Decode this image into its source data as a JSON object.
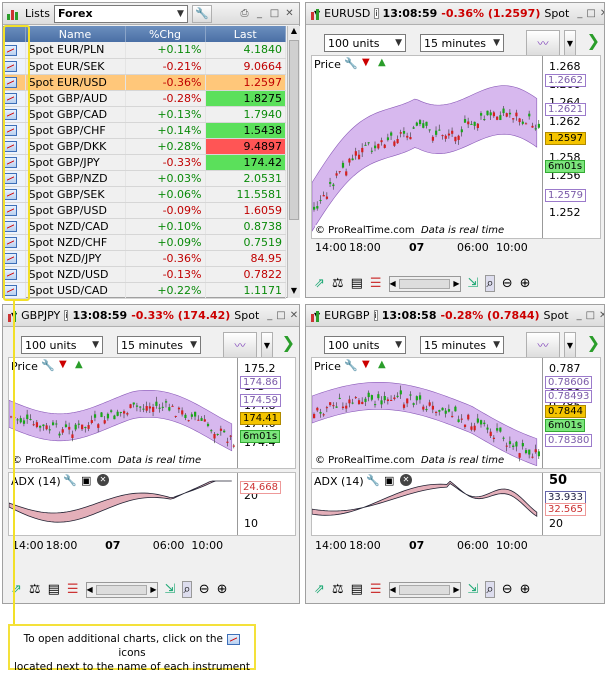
{
  "watchlist": {
    "title": "Lists",
    "list_name": "Forex",
    "columns": [
      "Name",
      "%Chg",
      "Last"
    ],
    "rows": [
      {
        "name": "Spot EUR/PLN",
        "chg": "+0.11%",
        "last": "4.1840",
        "dir": "pos"
      },
      {
        "name": "Spot EUR/SEK",
        "chg": "-0.21%",
        "last": "9.0664",
        "dir": "neg"
      },
      {
        "name": "Spot EUR/USD",
        "chg": "-0.36%",
        "last": "1.2597",
        "dir": "neg",
        "highlight": true
      },
      {
        "name": "Spot GBP/AUD",
        "chg": "-0.28%",
        "last": "1.8275",
        "dir": "neg",
        "flash": "up"
      },
      {
        "name": "Spot GBP/CAD",
        "chg": "+0.13%",
        "last": "1.7940",
        "dir": "pos"
      },
      {
        "name": "Spot GBP/CHF",
        "chg": "+0.14%",
        "last": "1.5438",
        "dir": "pos",
        "flash": "up"
      },
      {
        "name": "Spot GBP/DKK",
        "chg": "+0.28%",
        "last": "9.4897",
        "dir": "pos",
        "flash": "down"
      },
      {
        "name": "Spot GBP/JPY",
        "chg": "-0.33%",
        "last": "174.42",
        "dir": "neg",
        "flash": "up"
      },
      {
        "name": "Spot GBP/NZD",
        "chg": "+0.03%",
        "last": "2.0531",
        "dir": "pos"
      },
      {
        "name": "Spot GBP/SEK",
        "chg": "+0.06%",
        "last": "11.5581",
        "dir": "pos"
      },
      {
        "name": "Spot GBP/USD",
        "chg": "-0.09%",
        "last": "1.6059",
        "dir": "neg"
      },
      {
        "name": "Spot NZD/CAD",
        "chg": "+0.10%",
        "last": "0.8738",
        "dir": "pos"
      },
      {
        "name": "Spot NZD/CHF",
        "chg": "+0.09%",
        "last": "0.7519",
        "dir": "pos"
      },
      {
        "name": "Spot NZD/JPY",
        "chg": "-0.36%",
        "last": "84.95",
        "dir": "neg"
      },
      {
        "name": "Spot NZD/USD",
        "chg": "-0.13%",
        "last": "0.7822",
        "dir": "neg"
      },
      {
        "name": "Spot USD/CAD",
        "chg": "+0.22%",
        "last": "1.1171",
        "dir": "pos"
      }
    ]
  },
  "charts": {
    "eurusd": {
      "symbol": "EURUSD",
      "time": "13:08:59",
      "change": "-0.36% (1.2597)",
      "type": "Spot",
      "units": "100 units",
      "period": "15 minutes",
      "price_label": "Price",
      "y_ticks": [
        "1.268",
        "1.266",
        "1.264",
        "1.262",
        "1.260",
        "1.258",
        "1.256",
        "1.254",
        "1.252"
      ],
      "tags": [
        "1.2662",
        "1.2621",
        "1.2597",
        "6m01s",
        "1.2579"
      ],
      "x_ticks": [
        "14:00",
        "18:00",
        "07",
        "06:00",
        "10:00"
      ],
      "footer": "© ProRealTime.com",
      "footer2": "Data is real time"
    },
    "gbpjpy": {
      "symbol": "GBPJPY",
      "time": "13:08:59",
      "change": "-0.33% (174.42)",
      "type": "Spot",
      "units": "100 units",
      "period": "15 minutes",
      "price_label": "Price",
      "y_ticks": [
        "175.2",
        "175",
        "174.8",
        "174.6",
        "174.4"
      ],
      "tags": [
        "174.86",
        "174.59",
        "174.41",
        "6m01s"
      ],
      "adx_label": "ADX (14)",
      "adx_ticks": [
        "20",
        "10"
      ],
      "adx_tags": [
        "24.668"
      ],
      "x_ticks": [
        "14:00",
        "18:00",
        "07",
        "06:00",
        "10:00"
      ],
      "footer": "© ProRealTime.com",
      "footer2": "Data is real time"
    },
    "eurgbp": {
      "symbol": "EURGBP",
      "time": "13:08:58",
      "change": "-0.28% (0.7844)",
      "type": "Spot",
      "units": "100 units",
      "period": "15 minutes",
      "price_label": "Price",
      "y_ticks": [
        "0.787",
        "0.786",
        "0.785",
        "0.784",
        "0.783"
      ],
      "tags": [
        "0.78606",
        "0.78493",
        "0.7844",
        "6m01s",
        "0.78380"
      ],
      "adx_label": "ADX (14)",
      "adx_ticks": [
        "50",
        "20"
      ],
      "adx_tags": [
        "33.933",
        "32.565"
      ],
      "x_ticks": [
        "14:00",
        "18:00",
        "07",
        "06:00",
        "10:00"
      ],
      "footer": "© ProRealTime.com",
      "footer2": "Data is real time"
    }
  },
  "callout": {
    "text1": "To open additional charts, click on the",
    "text2": "icons",
    "text3": "located next to the name of each instrument"
  },
  "colors": {
    "up": "#5be05b",
    "down": "#ff5555",
    "highlight": "#ffc77a",
    "band": "#c9a0e8",
    "callout_border": "#f4e13a"
  }
}
